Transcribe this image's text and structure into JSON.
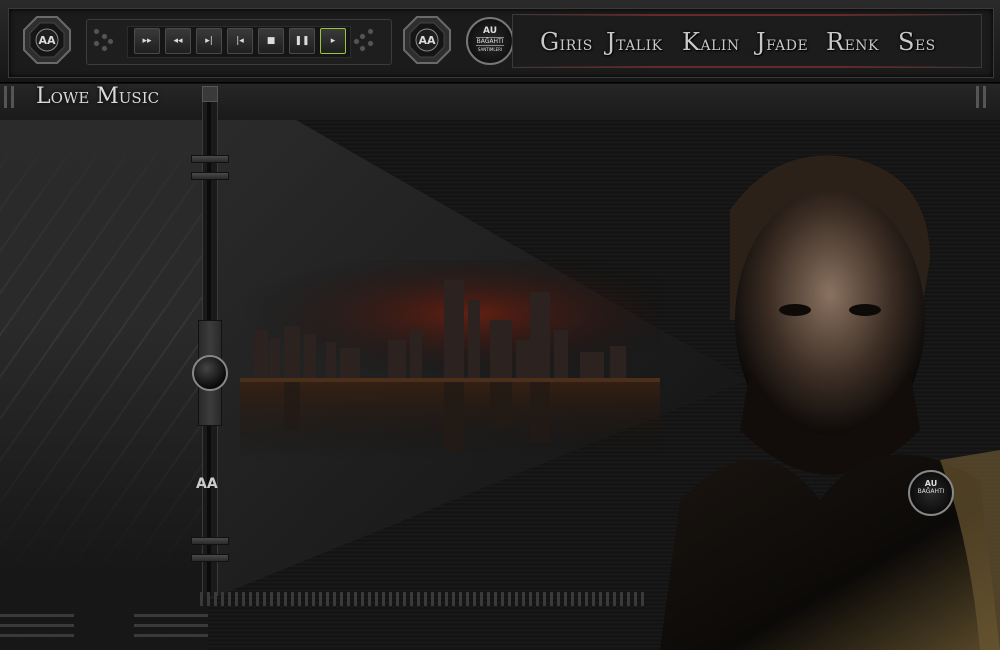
{
  "header": {
    "badge_text": "AA",
    "transport": [
      {
        "name": "fast-forward",
        "glyph": "▸▸",
        "active": false
      },
      {
        "name": "rewind",
        "glyph": "◂◂",
        "active": false
      },
      {
        "name": "next-track",
        "glyph": "▸|",
        "active": false
      },
      {
        "name": "previous-track",
        "glyph": "|◂",
        "active": false
      },
      {
        "name": "stop",
        "glyph": "■",
        "active": false
      },
      {
        "name": "pause",
        "glyph": "❚❚",
        "active": false
      },
      {
        "name": "play",
        "glyph": "▸",
        "active": true
      }
    ],
    "logo": {
      "line1": "AU",
      "line2": "BAĞAHTI",
      "line3": "SANTIMLERI"
    },
    "nav": [
      "Giris",
      "Jtalik",
      "Kalin",
      "Jfade",
      "Renk",
      "Ses"
    ],
    "accent_color": "#8b1a1a",
    "active_button_color": "#9ac43a"
  },
  "page": {
    "title": "Lowe Music",
    "slider_badge": "AA",
    "seal": {
      "line1": "AU",
      "line2": "BAĞAHTI"
    }
  }
}
